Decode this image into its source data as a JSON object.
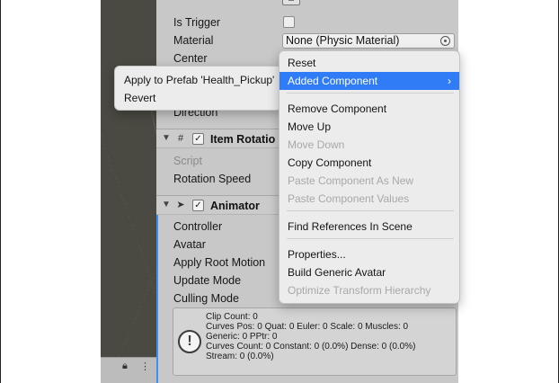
{
  "inspector": {
    "collider": {
      "is_trigger_label": "Is Trigger",
      "material_label": "Material",
      "material_value": "None (Physic Material)",
      "center_label": "Center",
      "direction_label": "Direction"
    },
    "item_rotation": {
      "title": "Item Rotatio",
      "script_label": "Script",
      "rotation_speed_label": "Rotation Speed"
    },
    "animator": {
      "title": "Animator",
      "fields": [
        "Controller",
        "Avatar",
        "Apply Root Motion",
        "Update Mode",
        "Culling Mode"
      ],
      "info_lines": [
        "Clip Count: 0",
        "Curves Pos: 0 Quat: 0 Euler: 0 Scale: 0 Muscles: 0",
        "Generic: 0 PPtr: 0",
        "Curves Count: 0 Constant: 0 (0.0%) Dense: 0 (0.0%)",
        "Stream: 0 (0.0%)"
      ],
      "info_icon": "!"
    }
  },
  "context_menu": {
    "items": [
      {
        "label": "Reset",
        "enabled": true
      },
      {
        "label": "Added Component",
        "enabled": true,
        "highlighted": true,
        "submenu": true
      },
      {
        "label": "Remove Component",
        "enabled": true
      },
      {
        "label": "Move Up",
        "enabled": true
      },
      {
        "label": "Move Down",
        "enabled": false
      },
      {
        "label": "Copy Component",
        "enabled": true
      },
      {
        "label": "Paste Component As New",
        "enabled": false
      },
      {
        "label": "Paste Component Values",
        "enabled": false
      },
      {
        "label": "Find References In Scene",
        "enabled": true
      },
      {
        "label": "Properties...",
        "enabled": true
      },
      {
        "label": "Build Generic Avatar",
        "enabled": true
      },
      {
        "label": "Optimize Transform Hierarchy",
        "enabled": false
      }
    ],
    "submenu_arrow": "›"
  },
  "submenu": {
    "items": [
      "Apply to Prefab 'Health_Pickup'",
      "Revert"
    ]
  },
  "colors": {
    "highlight": "#2f7cf6",
    "inspector_bg": "#c8c8c8",
    "scene_bg": "#4a4a42",
    "selection_bar": "#3b8ff5"
  }
}
